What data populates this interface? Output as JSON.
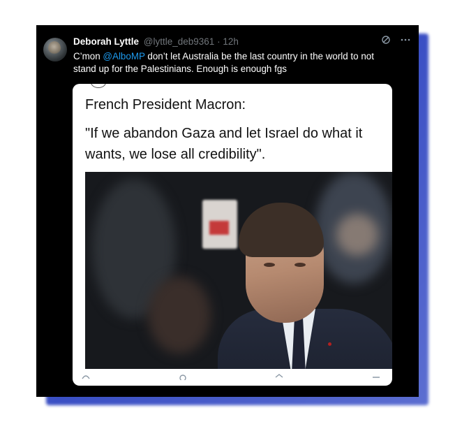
{
  "post": {
    "author_name": "Deborah Lyttle",
    "author_handle": "@lyttle_deb9361",
    "separator": "·",
    "time": "12h",
    "text_before": "C’mon ",
    "mention": "@AlboMP",
    "text_after": " don’t let Australia be the last country in the world to not stand up for the Palestinians. Enough is enough fgs",
    "icons": [
      "grok-icon",
      "more-icon"
    ]
  },
  "card": {
    "title": "French President Macron:",
    "quote": "\"If we abandon Gaza and let Israel do what it wants, we lose all credibility\"."
  },
  "colors": {
    "background": "#000000",
    "mention": "#1d9bf0",
    "shadow": "#3a4fc4"
  }
}
